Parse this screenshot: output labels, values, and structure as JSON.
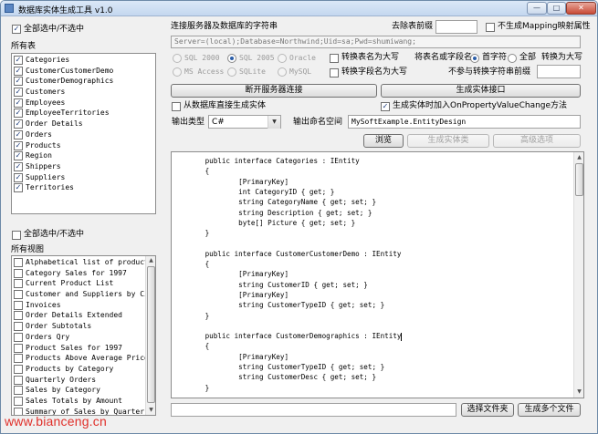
{
  "window": {
    "title": "数据库实体生成工具 v1.0",
    "controls": {
      "minimize": "—",
      "maximize": "□",
      "close": "✕"
    }
  },
  "left": {
    "select_all_tables_label": "全部选中/不选中",
    "tables_heading": "所有表",
    "tables": [
      {
        "name": "Categories",
        "checked": true
      },
      {
        "name": "CustomerCustomerDemo",
        "checked": true
      },
      {
        "name": "CustomerDemographics",
        "checked": true
      },
      {
        "name": "Customers",
        "checked": true
      },
      {
        "name": "Employees",
        "checked": true
      },
      {
        "name": "EmployeeTerritories",
        "checked": true
      },
      {
        "name": "Order Details",
        "checked": true
      },
      {
        "name": "Orders",
        "checked": true
      },
      {
        "name": "Products",
        "checked": true
      },
      {
        "name": "Region",
        "checked": true
      },
      {
        "name": "Shippers",
        "checked": true
      },
      {
        "name": "Suppliers",
        "checked": true
      },
      {
        "name": "Territories",
        "checked": true
      }
    ],
    "select_all_views_label": "全部选中/不选中",
    "views_heading": "所有视图",
    "views": [
      {
        "name": "Alphabetical list of products",
        "checked": false
      },
      {
        "name": "Category Sales for 1997",
        "checked": false
      },
      {
        "name": "Current Product List",
        "checked": false
      },
      {
        "name": "Customer and Suppliers by City",
        "checked": false
      },
      {
        "name": "Invoices",
        "checked": false
      },
      {
        "name": "Order Details Extended",
        "checked": false
      },
      {
        "name": "Order Subtotals",
        "checked": false
      },
      {
        "name": "Orders Qry",
        "checked": false
      },
      {
        "name": "Product Sales for 1997",
        "checked": false
      },
      {
        "name": "Products Above Average Price",
        "checked": false
      },
      {
        "name": "Products by Category",
        "checked": false
      },
      {
        "name": "Quarterly Orders",
        "checked": false
      },
      {
        "name": "Sales by Category",
        "checked": false
      },
      {
        "name": "Sales Totals by Amount",
        "checked": false
      },
      {
        "name": "Summary of Sales by Quarter",
        "checked": false
      }
    ]
  },
  "connection": {
    "label": "连接服务器及数据库的字符串",
    "remove_prefix_label": "去除表前缀",
    "remove_prefix_value": "",
    "no_mapping_label": "不生成Mapping映射属性",
    "connection_string": "Server=(local);Database=Northwind;Uid=sa;Pwd=shumiwang;",
    "db_types": [
      {
        "label": "SQL 2000",
        "selected": false
      },
      {
        "label": "SQL 2005",
        "selected": true
      },
      {
        "label": "Oracle",
        "selected": false
      },
      {
        "label": "MS Access",
        "selected": false
      },
      {
        "label": "SQLite",
        "selected": false
      },
      {
        "label": "MySQL",
        "selected": false
      }
    ],
    "upper_table_label": "转换表名为大写",
    "upper_field_label": "转换字段名为大写",
    "convert_label": "将表名或字段名",
    "convert_options": [
      {
        "label": "首字符",
        "selected": true
      },
      {
        "label": "全部",
        "selected": false
      }
    ],
    "convert_suffix": "转换为大写",
    "skip_prefix_label": "不参与转换字符串前缀",
    "skip_prefix_value": "",
    "disconnect_button": "断开服务器连接",
    "generate_interface_button": "生成实体接口",
    "from_db_label": "从数据库直接生成实体",
    "property_changed_label": "生成实体时加入OnPropertyValueChange方法",
    "output_type_label": "输出类型",
    "output_type_value": "C#",
    "namespace_label": "输出命名空间",
    "namespace_value": "MySoftExample.EntityDesign",
    "browse_button": "浏览",
    "generate_class_button": "生成实体类",
    "advanced_button": "高级选项"
  },
  "code": {
    "lines": [
      "        public interface Categories : IEntity",
      "        {",
      "                [PrimaryKey]",
      "                int CategoryID { get; }",
      "                string CategoryName { get; set; }",
      "                string Description { get; set; }",
      "                byte[] Picture { get; set; }",
      "        }",
      "",
      "        public interface CustomerCustomerDemo : IEntity",
      "        {",
      "                [PrimaryKey]",
      "                string CustomerID { get; set; }",
      "                [PrimaryKey]",
      "                string CustomerTypeID { get; set; }",
      "        }",
      "",
      "        public interface CustomerDemographics : IEntity",
      "        {",
      "                [PrimaryKey]",
      "                string CustomerTypeID { get; set; }",
      "                string CustomerDesc { get; set; }",
      "        }"
    ]
  },
  "bottom": {
    "path_value": "",
    "choose_folder_button": "选择文件夹",
    "generate_files_button": "生成多个文件"
  },
  "watermark": "www.bianceng.cn"
}
